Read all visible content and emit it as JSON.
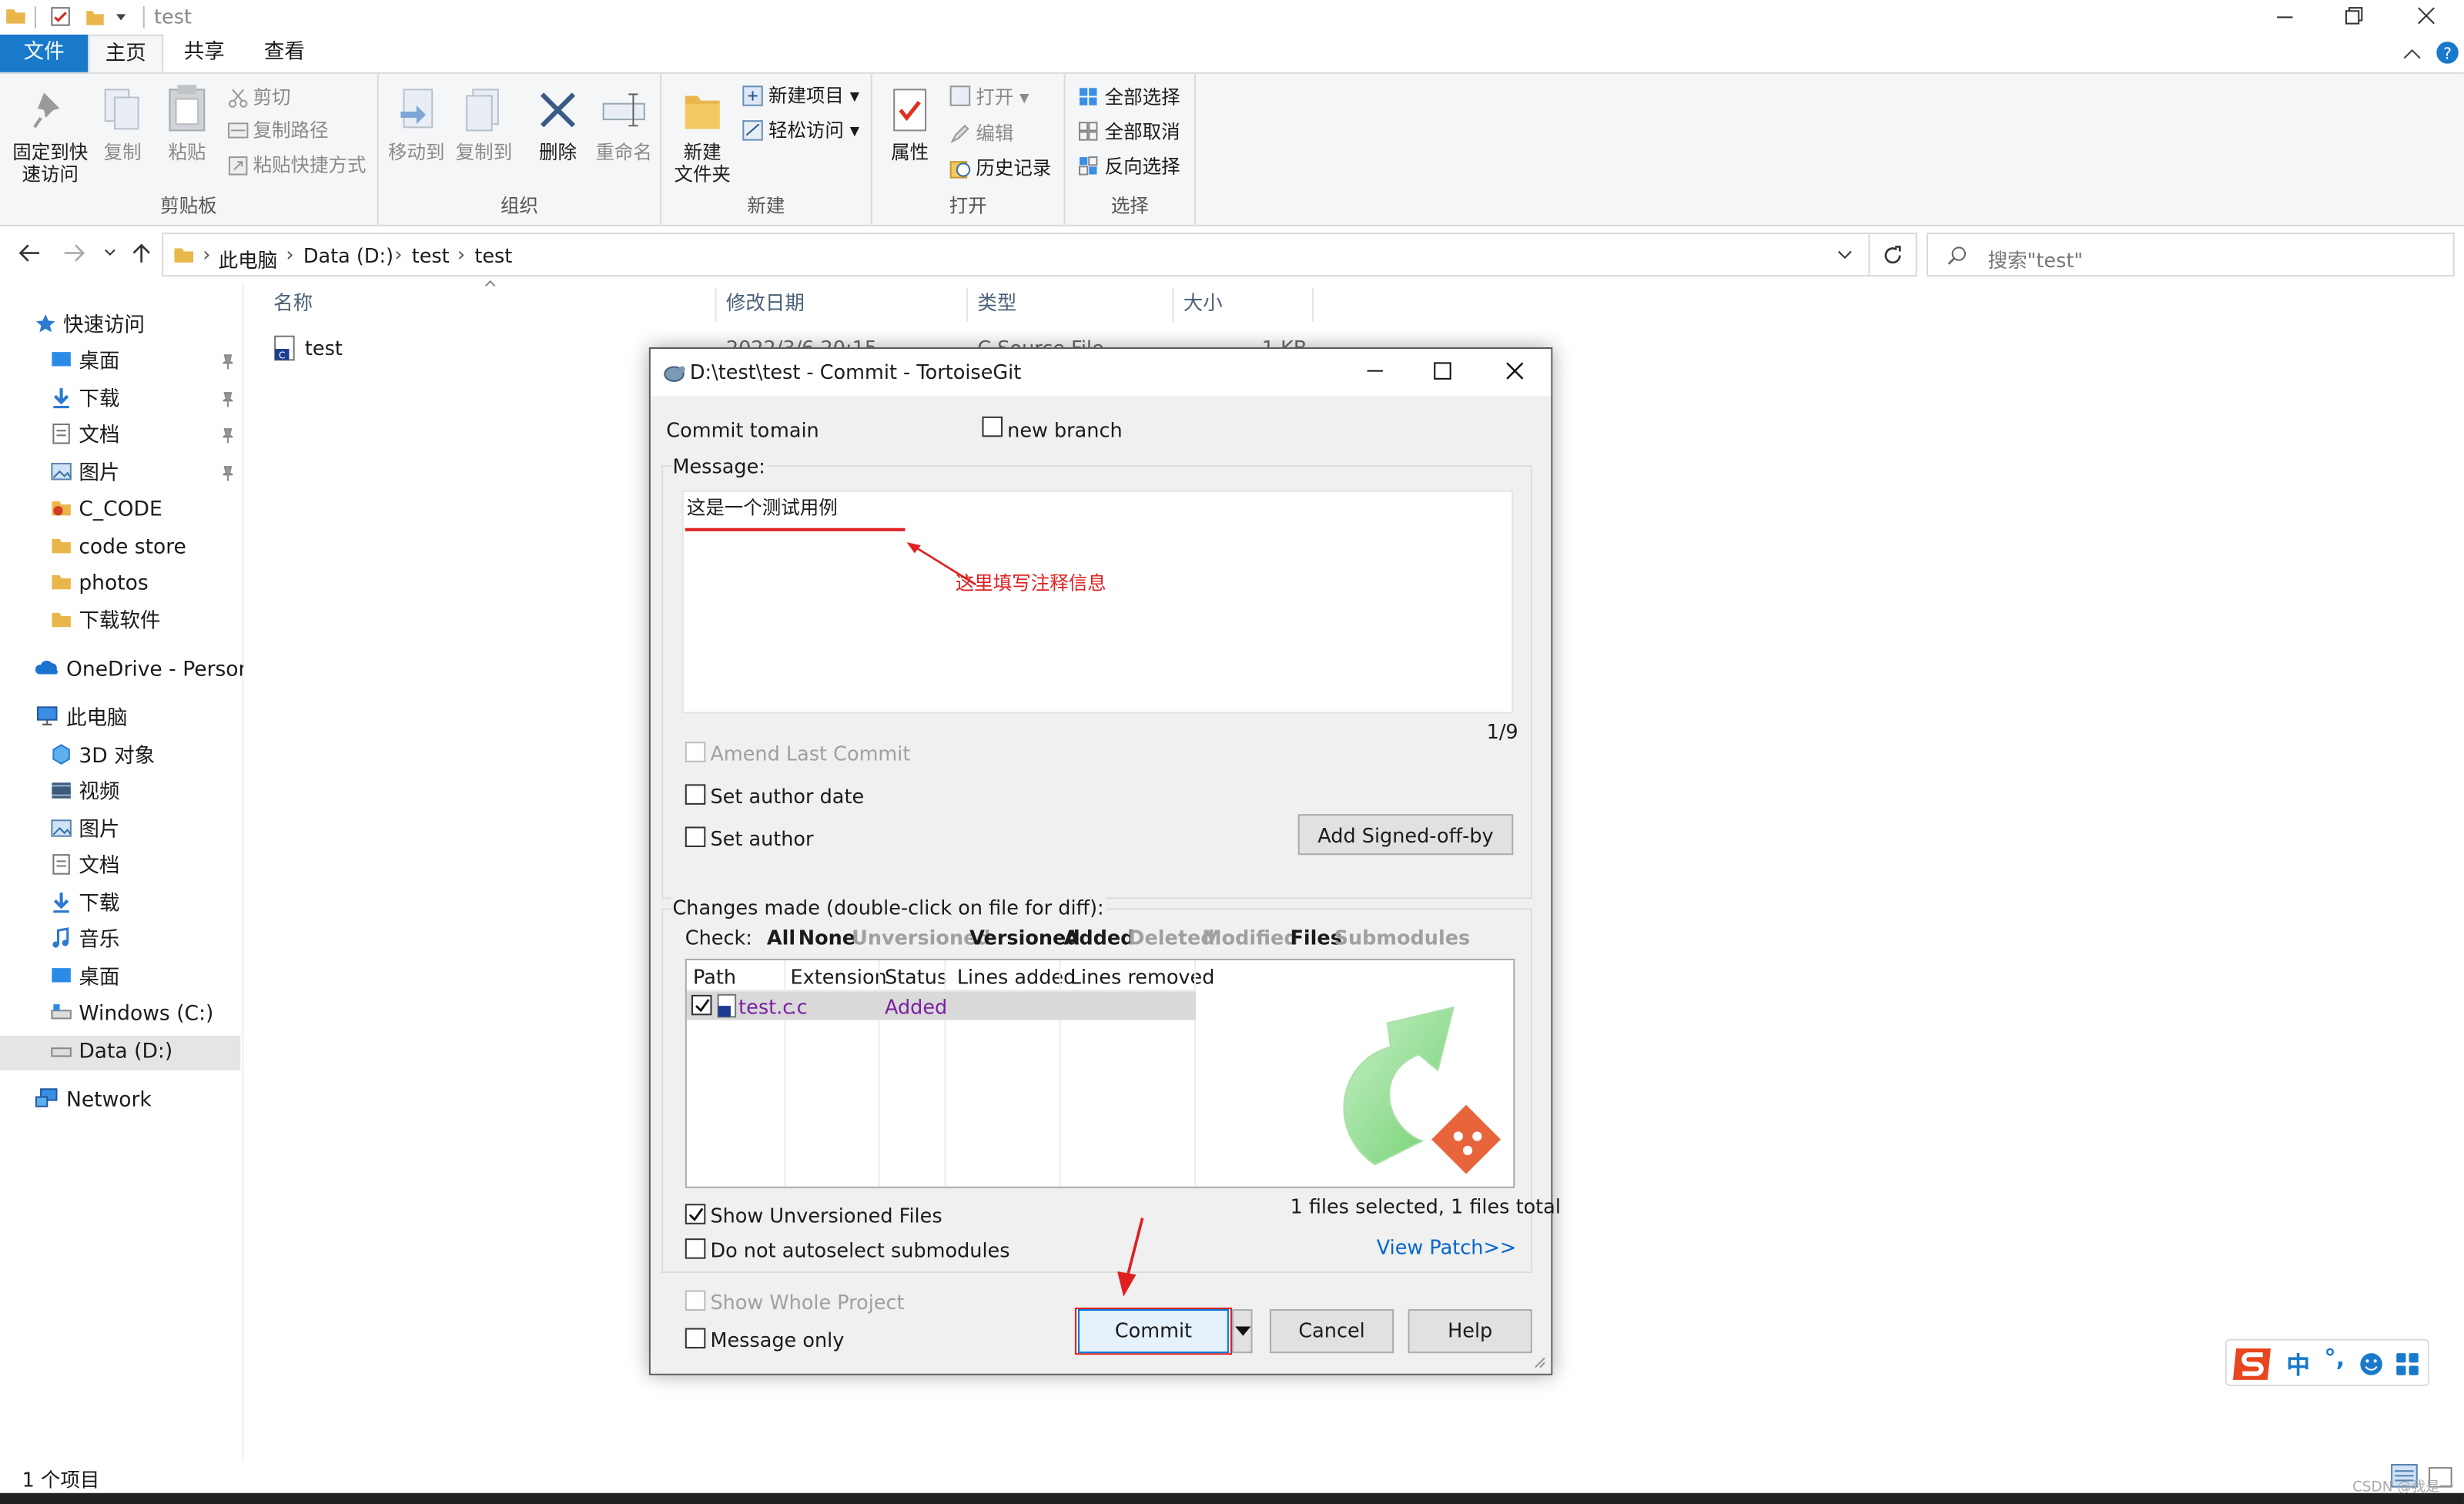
{
  "explorer": {
    "window_title": "test",
    "tabs": {
      "file": "文件",
      "home": "主页",
      "share": "共享",
      "view": "查看"
    },
    "ribbon": {
      "pin": "固定到快\n速访问",
      "copy": "复制",
      "paste": "粘贴",
      "cut": "剪切",
      "copy_path": "复制路径",
      "paste_shortcut": "粘贴快捷方式",
      "group_clipboard": "剪贴板",
      "move_to": "移动到",
      "copy_to": "复制到",
      "delete": "删除",
      "rename": "重命名",
      "group_organize": "组织",
      "new_folder": "新建\n文件夹",
      "new_item": "新建项目",
      "easy_access": "轻松访问",
      "group_new": "新建",
      "properties": "属性",
      "open": "打开",
      "edit": "编辑",
      "history": "历史记录",
      "group_open": "打开",
      "select_all": "全部选择",
      "select_none": "全部取消",
      "invert_selection": "反向选择",
      "group_select": "选择"
    },
    "breadcrumb": [
      "此电脑",
      "Data (D:)",
      "test",
      "test"
    ],
    "search_placeholder": "搜索\"test\"",
    "columns": {
      "name": "名称",
      "modified": "修改日期",
      "type": "类型",
      "size": "大小"
    },
    "files": [
      {
        "name": "test",
        "modified": "2022/3/6 20:15",
        "type": "C Source File",
        "size": "1 KB"
      }
    ],
    "nav": {
      "quick_access": "快速访问",
      "desktop": "桌面",
      "downloads": "下载",
      "documents": "文档",
      "pictures": "图片",
      "c_code": "C_CODE",
      "code_store": "code store",
      "photos": "photos",
      "download_software": "下载软件",
      "onedrive": "OneDrive - Persona",
      "this_pc": "此电脑",
      "objects_3d": "3D 对象",
      "videos": "视频",
      "pc_pictures": "图片",
      "pc_documents": "文档",
      "pc_downloads": "下载",
      "music": "音乐",
      "pc_desktop": "桌面",
      "windows_c": "Windows (C:)",
      "data_d": "Data (D:)",
      "network": "Network"
    },
    "status_count": "1 个项目"
  },
  "dialog": {
    "title": "D:\\test\\test - Commit - TortoiseGit",
    "commit_to_label": "Commit to:",
    "branch": "main",
    "new_branch": "new branch",
    "message_label": "Message:",
    "message_text": "这是一个测试用例",
    "annotation": "这里填写注释信息",
    "counter": "1/9",
    "amend_last_commit": "Amend Last Commit",
    "set_author_date": "Set author date",
    "set_author": "Set author",
    "add_signed_off": "Add Signed-off-by",
    "changes_label": "Changes made (double-click on file for diff):",
    "check_label": "Check:",
    "filters": {
      "all": "All",
      "none": "None",
      "unversioned": "Unversioned",
      "versioned": "Versioned",
      "added": "Added",
      "deleted": "Deleted",
      "modified": "Modified",
      "files": "Files",
      "submodules": "Submodules"
    },
    "list_headers": {
      "path": "Path",
      "extension": "Extension",
      "status": "Status",
      "lines_added": "Lines added",
      "lines_removed": "Lines removed"
    },
    "rows": [
      {
        "path": "test.c",
        "extension": ".c",
        "status": "Added",
        "checked": true
      }
    ],
    "show_unversioned": "Show Unversioned Files",
    "no_autoselect": "Do not autoselect submodules",
    "files_selected": "1 files selected, 1 files total",
    "view_patch": "View Patch>>",
    "show_whole_project": "Show Whole Project",
    "message_only": "Message only",
    "commit_button": "Commit",
    "cancel_button": "Cancel",
    "help_button": "Help"
  },
  "ime": {
    "lang": "中"
  },
  "watermark": "CSDN @我是一",
  "colors": {
    "accent": "#1979ca",
    "annotation_red": "#e02020",
    "added_status": "#7a1fa2",
    "link_blue": "#0066cc"
  }
}
